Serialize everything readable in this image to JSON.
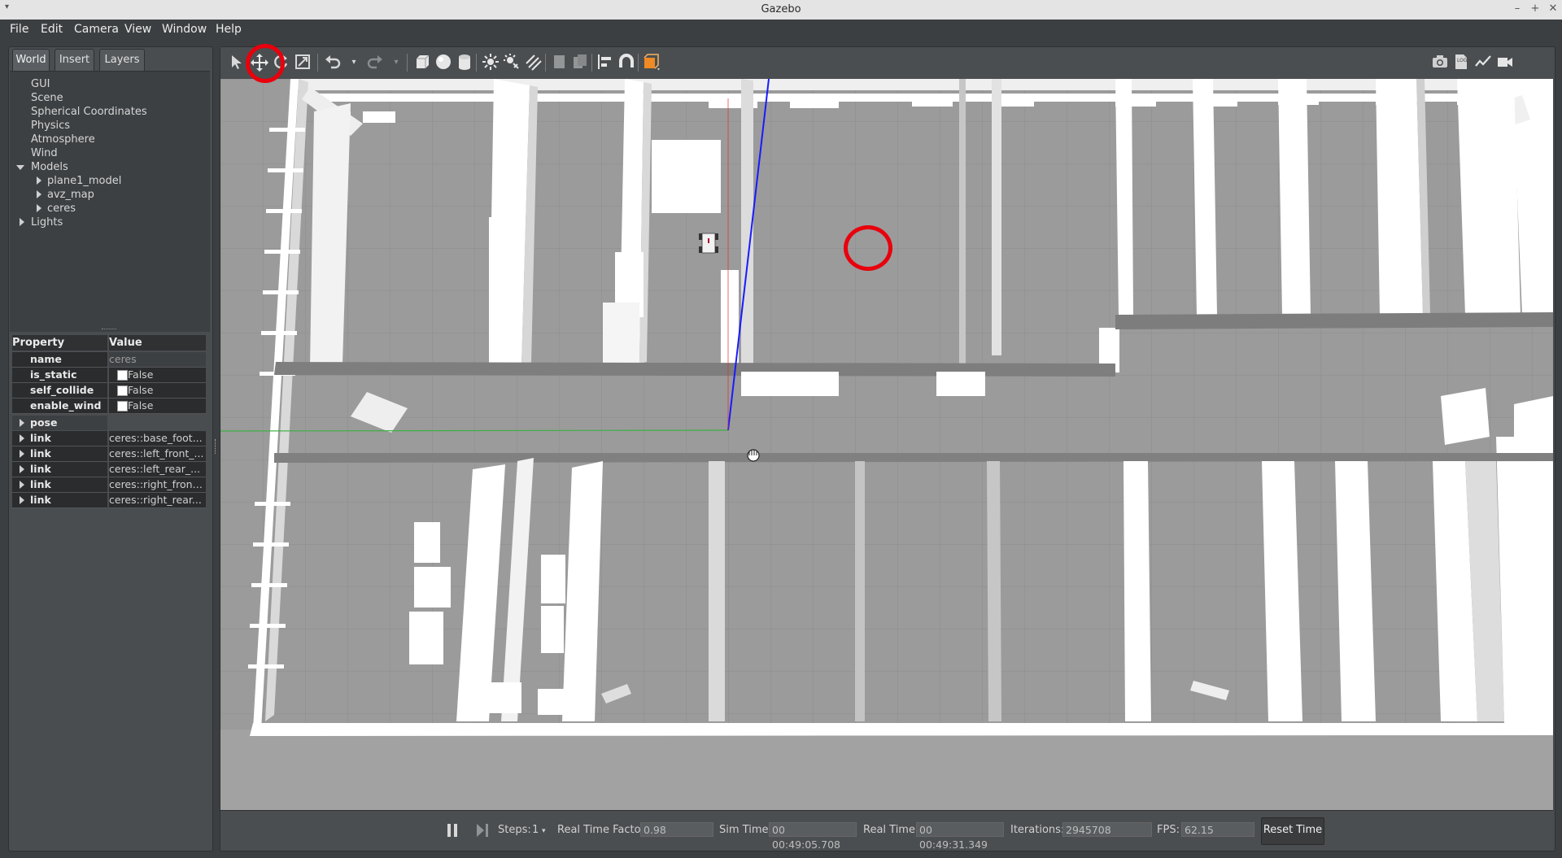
{
  "window": {
    "title": "Gazebo"
  },
  "menu": [
    "File",
    "Edit",
    "Camera",
    "View",
    "Window",
    "Help"
  ],
  "left_panel": {
    "tabs": [
      "World",
      "Insert",
      "Layers"
    ],
    "active_tab": "World",
    "tree": {
      "items": [
        "GUI",
        "Scene",
        "Spherical Coordinates",
        "Physics",
        "Atmosphere",
        "Wind"
      ],
      "models_label": "Models",
      "models": [
        "plane1_model",
        "avz_map",
        "ceres"
      ],
      "lights_label": "Lights"
    },
    "properties": {
      "header_property": "Property",
      "header_value": "Value",
      "rows": [
        {
          "key": "name",
          "value": "ceres"
        },
        {
          "key": "is_static",
          "value": "False"
        },
        {
          "key": "self_collide",
          "value": "False"
        },
        {
          "key": "enable_wind",
          "value": "False"
        },
        {
          "key": "pose",
          "value": ""
        },
        {
          "key": "link",
          "value": "ceres::base_foot..."
        },
        {
          "key": "link",
          "value": "ceres::left_front_..."
        },
        {
          "key": "link",
          "value": "ceres::left_rear_..."
        },
        {
          "key": "link",
          "value": "ceres::right_front..."
        },
        {
          "key": "link",
          "value": "ceres::right_rear..."
        }
      ]
    }
  },
  "toolbar": {
    "tools": [
      "select-mode",
      "translate-mode",
      "rotate-mode",
      "scale-mode",
      "undo",
      "undo-history",
      "redo",
      "redo-history",
      "box",
      "sphere",
      "cylinder",
      "point-light",
      "spot-light",
      "directional-light",
      "copy",
      "paste",
      "align",
      "snap",
      "change-view"
    ],
    "right_tools": [
      "screenshot",
      "log",
      "plot",
      "video-record"
    ],
    "highlighted_tool": "translate-mode"
  },
  "bottom_bar": {
    "steps_label": "Steps:",
    "steps_value": "1",
    "real_time_factor_label": "Real Time Factor:",
    "real_time_factor_value": "0.98",
    "sim_time_label": "Sim Time:",
    "sim_time_value": "00 00:49:05.708",
    "real_time_label": "Real Time:",
    "real_time_value": "00 00:49:31.349",
    "iterations_label": "Iterations:",
    "iterations_value": "2945708",
    "fps_label": "FPS:",
    "fps_value": "62.15",
    "reset_label": "Reset Time"
  },
  "colors": {
    "panel_bg": "#4a4d50",
    "highlight_red": "#e8000c",
    "ground": "#9a9a9a",
    "walls": "#ffffff",
    "z_axis": "#1a1aff",
    "y_axis": "#3cb043",
    "x_axis": "#ff2a2a"
  }
}
